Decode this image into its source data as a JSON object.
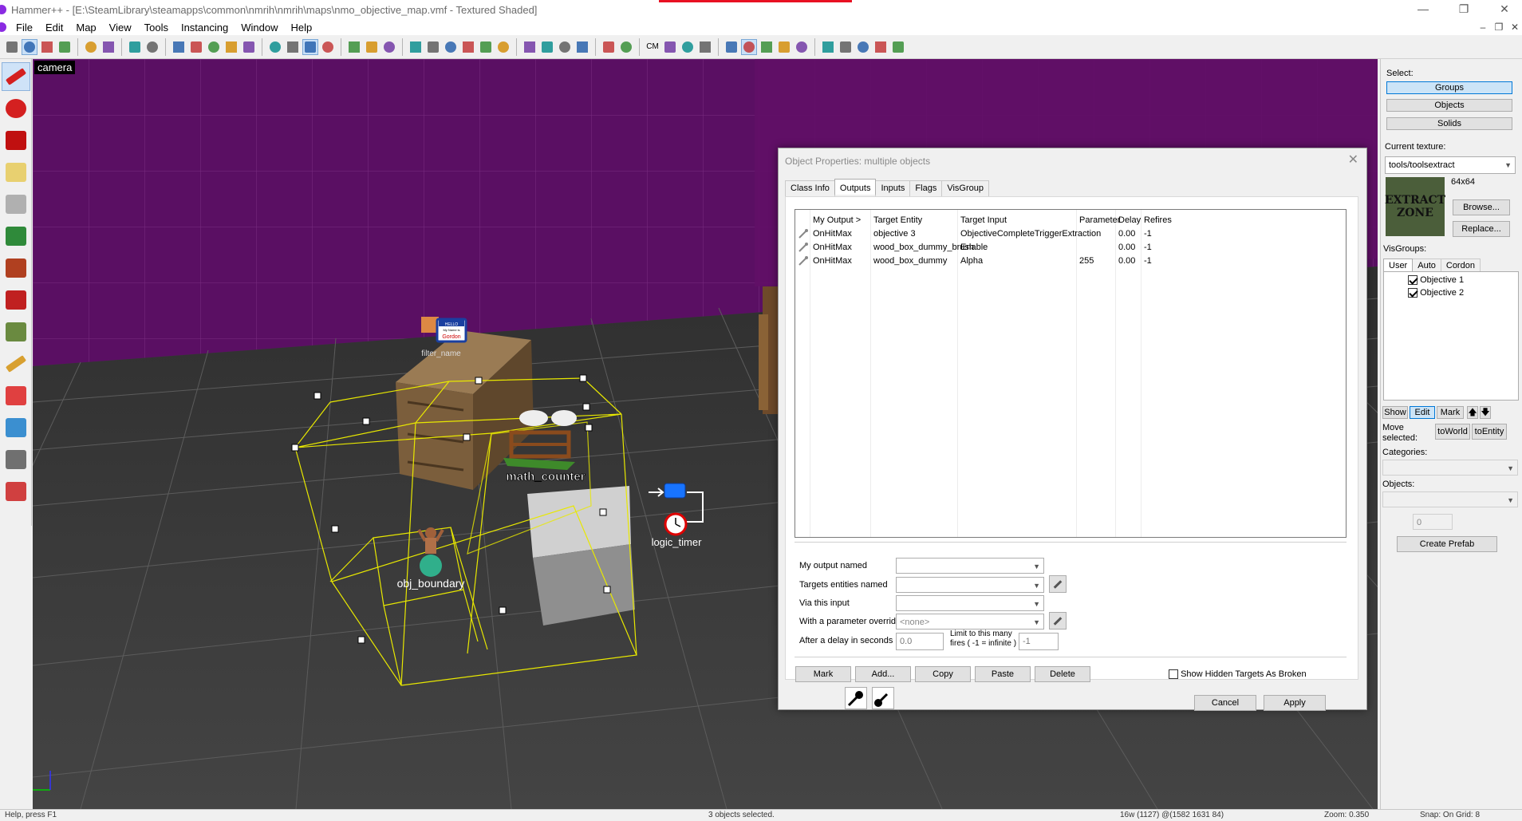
{
  "window": {
    "title": "Hammer++ - [E:\\SteamLibrary\\steamapps\\common\\nmrih\\nmrih\\maps\\nmo_objective_map.vmf - Textured Shaded]",
    "minimize": "—",
    "maximize": "❐",
    "close": "✕"
  },
  "menu": [
    "File",
    "Edit",
    "Map",
    "View",
    "Tools",
    "Instancing",
    "Window",
    "Help"
  ],
  "mdi_controls": [
    "–",
    "❐",
    "✕"
  ],
  "toolbar_icons": [
    "grid-icon",
    "grid-toggle-icon",
    "grid-dots-icon",
    "grid-snap-icon",
    "group-icon",
    "ungroup-icon",
    "undo-icon",
    "redo-icon",
    "carve-icon",
    "hollow-icon",
    "solid-visible-icon",
    "texture-lock-icon",
    "ignore-group-icon",
    "wireframe-icon",
    "textured-icon",
    "shaded-icon",
    "lightmap-icon",
    "cut-icon",
    "copy-icon",
    "paste-icon",
    "helpers-icon",
    "models-icon",
    "origin-icon",
    "select-by-handles-icon",
    "ignore-icon",
    "sprites-icon",
    "autovis-icon",
    "toolbar-icon-b",
    "toolbar-icon-c",
    "toolbar-icon-d",
    "compile-icon",
    "run-icon",
    "cm-icon",
    "lighting-preview-icon",
    "toolbar-icon-e",
    "toolbar-icon-f",
    "toolbar-icon-g",
    "toolbar-icon-h",
    "toolbar-icon-i",
    "toolbar-icon-j",
    "toolbar-icon-k",
    "toolbar-icon-l",
    "toolbar-icon-m",
    "toolbar-icon-n",
    "toolbar-icon-o",
    "toolbar-icon-p"
  ],
  "toolbar_cm": "CM",
  "left_tools": [
    "selection-tool-icon",
    "magnify-tool-icon",
    "camera-tool-icon",
    "entity-tool-icon",
    "block-tool-icon",
    "texture-application-icon",
    "apply-texture-icon",
    "decal-tool-icon",
    "overlay-tool-icon",
    "clipping-tool-icon",
    "vertex-tool-icon",
    "path-tool-icon",
    "sweep-tool-icon",
    "terrain-tool-icon"
  ],
  "viewport": {
    "label": "camera",
    "entities": {
      "filter": "filter_name",
      "counter": "math_counter",
      "timer": "logic_timer",
      "boundary": "obj_boundary"
    },
    "sign_text": [
      "HELLO",
      "My Name is",
      "Gordon"
    ]
  },
  "right_panel": {
    "select_label": "Select:",
    "select_buttons": [
      "Groups",
      "Objects",
      "Solids"
    ],
    "current_texture_label": "Current texture:",
    "current_texture": "tools/toolsextract",
    "texture_size": "64x64",
    "texture_preview_text": [
      "EXTRACT",
      "ZONE"
    ],
    "browse": "Browse...",
    "replace": "Replace...",
    "visgroups_label": "VisGroups:",
    "visgroup_tabs": [
      "User",
      "Auto",
      "Cordon"
    ],
    "visgroups": [
      {
        "name": "Objective 1",
        "checked": true
      },
      {
        "name": "Objective 2",
        "checked": true
      }
    ],
    "show": "Show",
    "edit": "Edit",
    "mark": "Mark",
    "up": "🡅",
    "down": "🡇",
    "move_selected": "Move selected:",
    "to_world": "toWorld",
    "to_entity": "toEntity",
    "categories_label": "Categories:",
    "objects_label": "Objects:",
    "spin_value": "0",
    "create_prefab": "Create Prefab"
  },
  "dialog": {
    "title": "Object Properties: multiple objects",
    "close": "✕",
    "tabs": [
      "Class Info",
      "Outputs",
      "Inputs",
      "Flags",
      "VisGroup"
    ],
    "columns": [
      "My Output  >",
      "Target Entity",
      "Target Input",
      "Parameter",
      "Delay",
      "Refires"
    ],
    "rows": [
      {
        "output": "OnHitMax",
        "target": "objective 3",
        "input": "ObjectiveCompleteTriggerExtraction",
        "param": "",
        "delay": "0.00",
        "refires": "-1"
      },
      {
        "output": "OnHitMax",
        "target": "wood_box_dummy_brush",
        "input": "Enable",
        "param": "",
        "delay": "0.00",
        "refires": "-1"
      },
      {
        "output": "OnHitMax",
        "target": "wood_box_dummy",
        "input": "Alpha",
        "param": "255",
        "delay": "0.00",
        "refires": "-1"
      }
    ],
    "form": {
      "my_output_named": "My output named",
      "targets_entities_named": "Targets entities named",
      "via_this_input": "Via this input",
      "param_override": "With a parameter override of",
      "param_value": "<none>",
      "delay_label": "After a delay in seconds of",
      "delay_value": "0.0",
      "limit_label": "Limit to this many fires ( -1 = infinite )",
      "limit_value": "-1"
    },
    "buttons": {
      "mark": "Mark",
      "add": "Add...",
      "copy": "Copy",
      "paste": "Paste",
      "delete": "Delete",
      "cancel": "Cancel",
      "apply": "Apply"
    },
    "show_hidden": "Show Hidden Targets As Broken"
  },
  "status": {
    "left": "Help, press F1",
    "center": "3 objects selected.",
    "coords": "16w (1127) @(1582 1631 84)",
    "zoom": "Zoom: 0.350",
    "snap": "Snap: On Grid: 8"
  }
}
